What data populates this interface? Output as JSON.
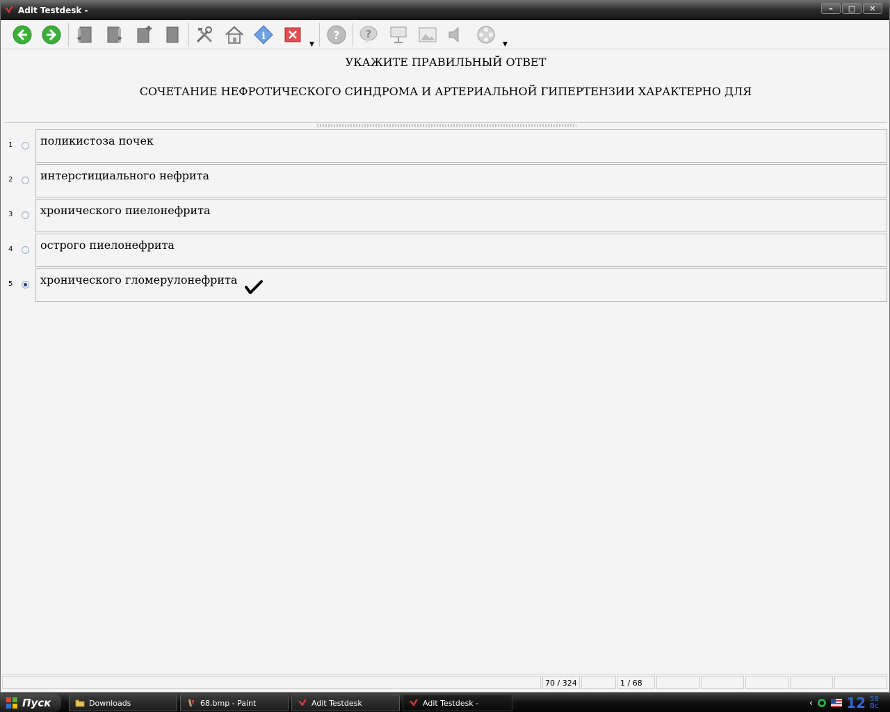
{
  "window": {
    "title": "Adit Testdesk -"
  },
  "toolbar": {
    "buttons": [
      {
        "name": "back-icon"
      },
      {
        "name": "forward-icon"
      },
      {
        "name": "book-prev-icon"
      },
      {
        "name": "book-next-icon"
      },
      {
        "name": "book-add-icon"
      },
      {
        "name": "book-icon"
      },
      {
        "name": "tools-icon"
      },
      {
        "name": "home-icon"
      },
      {
        "name": "info-icon"
      },
      {
        "name": "close-red-icon"
      },
      {
        "name": "help-circle-icon"
      },
      {
        "name": "help-bubble-icon"
      },
      {
        "name": "presentation-icon"
      },
      {
        "name": "picture-icon"
      },
      {
        "name": "sound-icon"
      },
      {
        "name": "film-icon"
      }
    ]
  },
  "question": {
    "title": "УКАЖИТЕ ПРАВИЛЬНЫЙ ОТВЕТ",
    "text": "СОЧЕТАНИЕ НЕФРОТИЧЕСКОГО СИНДРОМА И АРТЕРИАЛЬНОЙ ГИПЕРТЕНЗИИ ХАРАКТЕРНО ДЛЯ"
  },
  "answers": [
    {
      "num": "1",
      "text": "поликистоза почек"
    },
    {
      "num": "2",
      "text": "интерстициального нефрита"
    },
    {
      "num": "3",
      "text": "хронического пиелонефрита"
    },
    {
      "num": "4",
      "text": "острого пиелонефрита"
    },
    {
      "num": "5",
      "text": "хронического гломерулонефрита"
    }
  ],
  "status": {
    "progress": "70 / 324",
    "page": "1 / 68"
  },
  "taskbar": {
    "start": "Пуск",
    "tasks": [
      {
        "label": "Downloads"
      },
      {
        "label": "68.bmp - Paint"
      },
      {
        "label": "Adit Testdesk"
      },
      {
        "label": "Adit Testdesk -"
      }
    ],
    "clock_hour": "12",
    "clock_min": "58",
    "clock_day": "Вс"
  },
  "colors": {
    "accent": "#2c6ad6",
    "checked_radio": "#1f3f8f",
    "close_red": "#d83a3a",
    "green_nav": "#3cae3a"
  }
}
